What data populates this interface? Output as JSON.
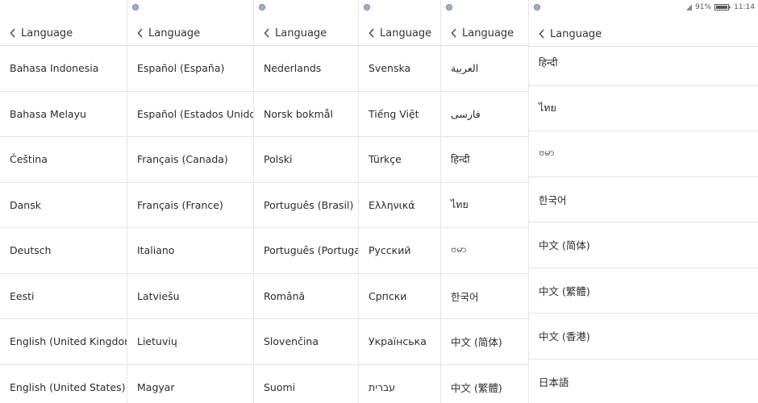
{
  "status": {
    "battery": "91%",
    "time": "11:14"
  },
  "panels": [
    {
      "title": "Language",
      "items": [
        "Bahasa Indonesia",
        "Bahasa Melayu",
        "Čeština",
        "Dansk",
        "Deutsch",
        "Eesti",
        "English (United Kingdom)",
        "English (United States)"
      ]
    },
    {
      "title": "Language",
      "items": [
        "Español (España)",
        "Español (Estados Unidos)",
        "Français (Canada)",
        "Français (France)",
        "Italiano",
        "Latviešu",
        "Lietuvių",
        "Magyar"
      ]
    },
    {
      "title": "Language",
      "items": [
        "Nederlands",
        "Norsk bokmål",
        "Polski",
        "Português (Brasil)",
        "Português (Portugal)",
        "Română",
        "Slovenčina",
        "Suomi"
      ]
    },
    {
      "title": "Language",
      "items": [
        "Svenska",
        "Tiếng Việt",
        "Türkçe",
        "Ελληνικά",
        "Русский",
        "Српски",
        "Українська",
        "עברית"
      ]
    },
    {
      "title": "Language",
      "items": [
        "العربية",
        "فارسی",
        "हिन्दी",
        "ไทย",
        "ဗမာ",
        "한국어",
        "中文 (简体)",
        "中文 (繁體)"
      ]
    },
    {
      "title": "Language",
      "items": [
        "हिन्दी",
        "ไทย",
        "ဗမာ",
        "한국어",
        "中文 (简体)",
        "中文 (繁體)",
        "中文 (香港)",
        "日本語"
      ]
    }
  ]
}
